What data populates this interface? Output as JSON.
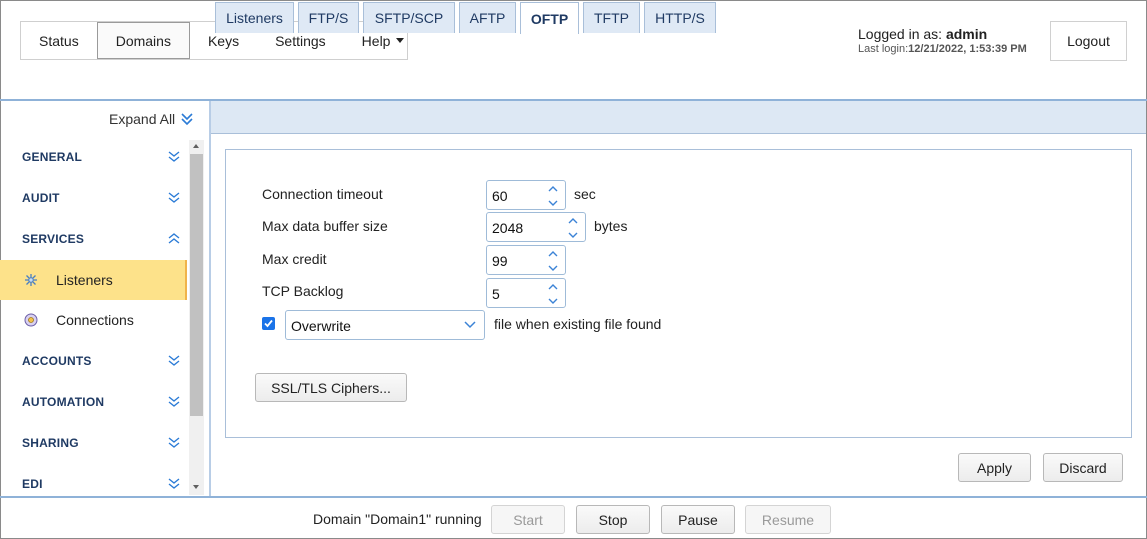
{
  "nav": {
    "items": [
      "Status",
      "Domains",
      "Keys",
      "Settings",
      "Help"
    ]
  },
  "user": {
    "logged_in_label": "Logged in as: ",
    "username": "admin",
    "last_login_label": "Last login:",
    "last_login_value": "12/21/2022, 1:53:39 PM",
    "logout_label": "Logout"
  },
  "sidebar": {
    "expand_all": "Expand All",
    "sections": {
      "general": "GENERAL",
      "audit": "AUDIT",
      "services": "SERVICES",
      "listeners": "Listeners",
      "connections": "Connections",
      "accounts": "ACCOUNTS",
      "automation": "AUTOMATION",
      "sharing": "SHARING",
      "edi": "EDI"
    }
  },
  "tabs": [
    "Listeners",
    "FTP/S",
    "SFTP/SCP",
    "AFTP",
    "OFTP",
    "TFTP",
    "HTTP/S"
  ],
  "form": {
    "connection_timeout": {
      "label": "Connection timeout",
      "value": "60",
      "unit": "sec"
    },
    "max_buffer": {
      "label": "Max data buffer size",
      "value": "2048",
      "unit": "bytes"
    },
    "max_credit": {
      "label": "Max credit",
      "value": "99"
    },
    "tcp_backlog": {
      "label": "TCP Backlog",
      "value": "5"
    },
    "overwrite": {
      "checked": true,
      "selected": "Overwrite",
      "suffix": "file when existing file found"
    },
    "ssl_button": "SSL/TLS Ciphers..."
  },
  "actions": {
    "apply": "Apply",
    "discard": "Discard"
  },
  "footer": {
    "status": "Domain \"Domain1\" running",
    "start": "Start",
    "stop": "Stop",
    "pause": "Pause",
    "resume": "Resume"
  },
  "colors": {
    "accent_blue": "#1f3a63",
    "selection": "#fde28a",
    "separator": "#8fb2d8"
  }
}
